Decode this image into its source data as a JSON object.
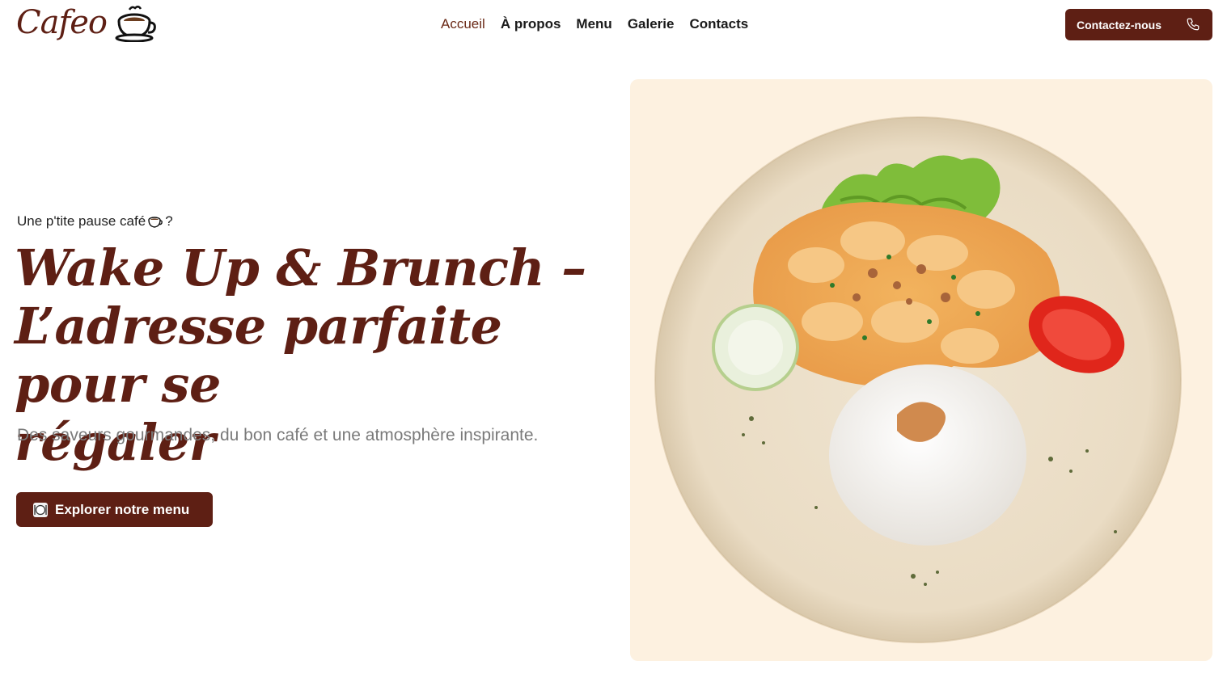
{
  "brand": {
    "name": "Cafeo",
    "logo_icon": "coffee-cup-icon"
  },
  "nav": {
    "items": [
      {
        "label": "Accueil",
        "active": true
      },
      {
        "label": "À propos",
        "active": false
      },
      {
        "label": "Menu",
        "active": false
      },
      {
        "label": "Galerie",
        "active": false
      },
      {
        "label": "Contacts",
        "active": false
      }
    ]
  },
  "header": {
    "contact_label": "Contactez-nous",
    "contact_icon": "phone-icon"
  },
  "hero": {
    "eyebrow": "Une p'tite pause café",
    "eyebrow_suffix": "?",
    "title_line1": "Wake Up & Brunch –",
    "title_line2": "L’adresse parfaite pour se",
    "title_line3": "régaler",
    "subtitle": "Des saveurs gourmandes, du bon café et une atmosphère inspirante.",
    "cta_label": "Explorer notre menu",
    "cta_icon": "plate-cutlery-icon",
    "image_icon": "dish-plate-image"
  },
  "colors": {
    "brand": "#5e1f14",
    "card_bg": "#fdf1e0",
    "subtitle": "#7a7a7a"
  }
}
